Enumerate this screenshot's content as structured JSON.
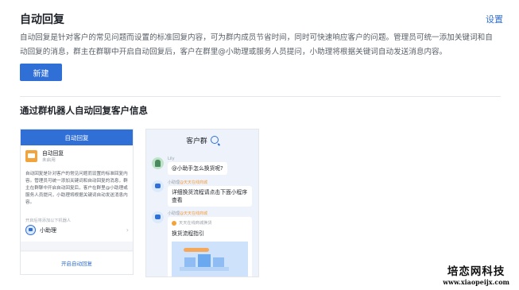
{
  "header": {
    "title": "自动回复",
    "settings_label": "设置",
    "description": "自动回复是针对客户的常见问题而设置的标准回复内容，可为群内成员节省时间，同时可快速响应客户的问题。管理员可统一添加关键词和自动回复的消息，群主在群聊中开启自动回复后，客户在群里@小助理或服务人员提问，小助理将根据关键词自动发送消息内容。",
    "new_button_label": "新建"
  },
  "section": {
    "title": "通过群机器人自动回复客户信息"
  },
  "left_card": {
    "header": "自动回复",
    "message_title": "自动回复",
    "message_status": "未启用",
    "description": "自动回复是针对客户的常见问题而设置的标准回复内容。管理员可统一添加关键词和自动回复的消息，群主在群聊中开启自动回复后，客户在群里@小助理或服务人员提问，小助理将根据关键词自动发送消息内容。",
    "hint": "开启后将添加以下机器人",
    "bot_name": "小助理",
    "footer_action": "开启自动回复"
  },
  "right_card": {
    "title": "客户群",
    "messages": [
      {
        "sender": "Lily",
        "tag": "",
        "text": "@小助手怎么换货呢?"
      },
      {
        "sender": "小助理",
        "tag": "@天天在线商城",
        "text": "详细换货流程请点击下面小程序查看"
      },
      {
        "sender": "小助理",
        "tag": "@天天在线商城",
        "card_source": "天天在线商城换货",
        "card_title": "换货流程指引"
      }
    ]
  },
  "watermark": {
    "name": "培恋网科技",
    "url": "www.xiaopeijx.com"
  },
  "colors": {
    "accent": "#2f6fd6",
    "warning": "#f2a33a"
  }
}
